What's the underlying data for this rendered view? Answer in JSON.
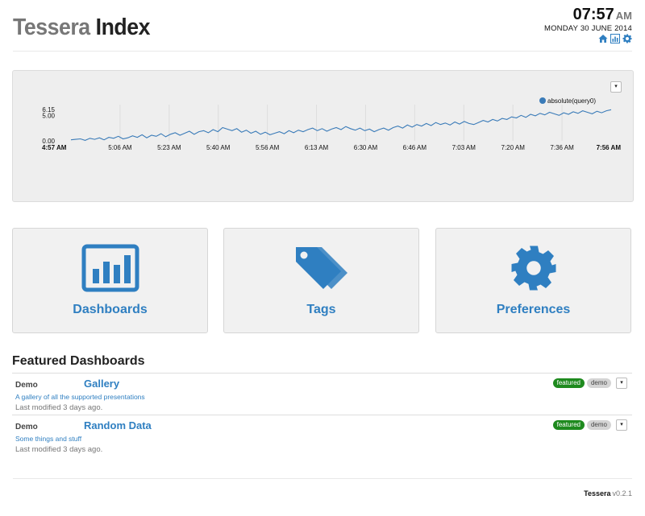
{
  "header": {
    "title_brand": "Tessera",
    "title_index": "Index",
    "clock_time": "07:57",
    "clock_ampm": "AM",
    "clock_date": "MONDAY 30 JUNE 2014",
    "icons": [
      "home-icon",
      "bar-chart-icon",
      "gear-icon"
    ]
  },
  "chart_panel": {
    "dropdown_glyph": "▾"
  },
  "chart_data": {
    "type": "line",
    "title": "",
    "xlabel": "",
    "ylabel": "",
    "ylim": [
      0,
      6.15
    ],
    "y_ticks": [
      "0.00",
      "5.00",
      "6.15"
    ],
    "x_ticks": [
      "4:57 AM",
      "5:06 AM",
      "5:23 AM",
      "5:40 AM",
      "5:56 AM",
      "6:13 AM",
      "6:30 AM",
      "6:46 AM",
      "7:03 AM",
      "7:20 AM",
      "7:36 AM",
      "7:56 AM"
    ],
    "x_range": [
      "4:57 AM",
      "7:56 AM"
    ],
    "grid": "x",
    "legend_placement": "top-right",
    "series": [
      {
        "name": "absolute(query0)",
        "color": "#3a7bb8",
        "values": [
          0.2,
          0.3,
          0.4,
          0.1,
          0.5,
          0.3,
          0.6,
          0.2,
          0.7,
          0.5,
          0.9,
          0.4,
          0.6,
          1.0,
          0.7,
          1.2,
          0.6,
          1.1,
          0.9,
          1.4,
          0.8,
          1.3,
          1.6,
          1.1,
          1.5,
          1.9,
          1.3,
          1.8,
          2.0,
          1.6,
          2.2,
          1.8,
          2.6,
          2.3,
          2.0,
          2.4,
          1.7,
          2.1,
          1.5,
          1.9,
          1.3,
          1.7,
          1.2,
          1.5,
          1.8,
          1.4,
          2.0,
          1.6,
          2.1,
          1.8,
          2.2,
          2.5,
          2.0,
          2.4,
          1.9,
          2.3,
          2.6,
          2.2,
          2.8,
          2.4,
          2.1,
          2.5,
          2.0,
          2.3,
          1.8,
          2.2,
          2.5,
          2.1,
          2.6,
          2.9,
          2.5,
          3.1,
          2.7,
          3.2,
          2.9,
          3.4,
          3.0,
          3.6,
          3.2,
          3.5,
          3.1,
          3.7,
          3.3,
          3.8,
          3.4,
          3.2,
          3.6,
          4.0,
          3.7,
          4.2,
          3.9,
          4.4,
          4.2,
          4.7,
          4.5,
          5.0,
          4.6,
          5.2,
          4.9,
          5.4,
          5.1,
          5.6,
          5.3,
          5.0,
          5.5,
          5.2,
          5.7,
          5.4,
          5.9,
          5.6,
          5.3,
          5.8,
          5.5,
          5.9,
          6.1
        ]
      }
    ]
  },
  "tiles": [
    {
      "label": "Dashboards",
      "icon": "bar-chart-icon"
    },
    {
      "label": "Tags",
      "icon": "tags-icon"
    },
    {
      "label": "Preferences",
      "icon": "gear-icon"
    }
  ],
  "featured": {
    "heading": "Featured Dashboards",
    "items": [
      {
        "category": "Demo",
        "title": "Gallery",
        "description": "A gallery of all the supported presentations",
        "modified": "Last modified 3 days ago.",
        "tags": [
          "featured",
          "demo"
        ]
      },
      {
        "category": "Demo",
        "title": "Random Data",
        "description": "Some things and stuff",
        "modified": "Last modified 3 days ago.",
        "tags": [
          "featured",
          "demo"
        ]
      }
    ]
  },
  "footer": {
    "brand": "Tessera",
    "version": "v0.2.1"
  },
  "colors": {
    "accent": "#2f7fc1",
    "featured_badge": "#1e8a1e",
    "demo_badge": "#d4d4d4"
  }
}
